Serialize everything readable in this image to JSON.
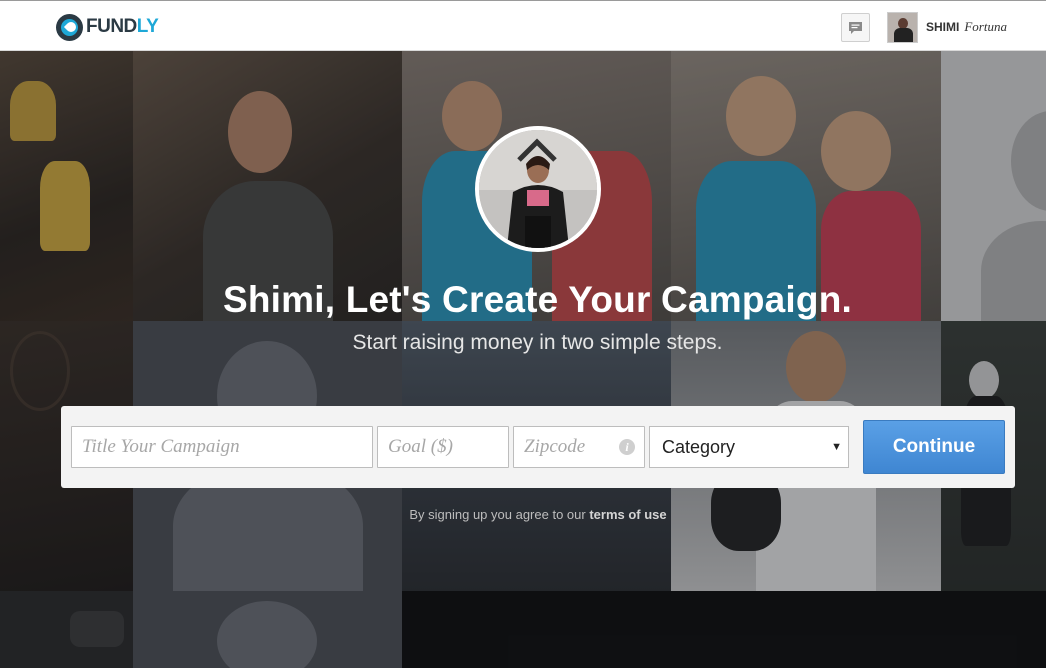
{
  "header": {
    "logo_text_main": "FUND",
    "logo_text_accent": "LY",
    "user_first": "SHIMI",
    "user_last": "Fortuna"
  },
  "hero": {
    "title": "Shimi, Let's Create Your Campaign.",
    "subtitle": "Start raising money in two simple steps."
  },
  "form": {
    "title_placeholder": "Title Your Campaign",
    "goal_placeholder": "Goal ($)",
    "zip_placeholder": "Zipcode",
    "info_glyph": "i",
    "category_selected": "Category",
    "category_caret": "▼",
    "continue_label": "Continue"
  },
  "terms": {
    "prefix": "By signing up you agree to our",
    "link": "terms of use"
  },
  "colors": {
    "brand_dark": "#2b3a44",
    "brand_accent": "#1ea8d7",
    "button_blue": "#4a90dc"
  },
  "icons": {
    "message": "speech-bubble",
    "info": "info-circle"
  }
}
